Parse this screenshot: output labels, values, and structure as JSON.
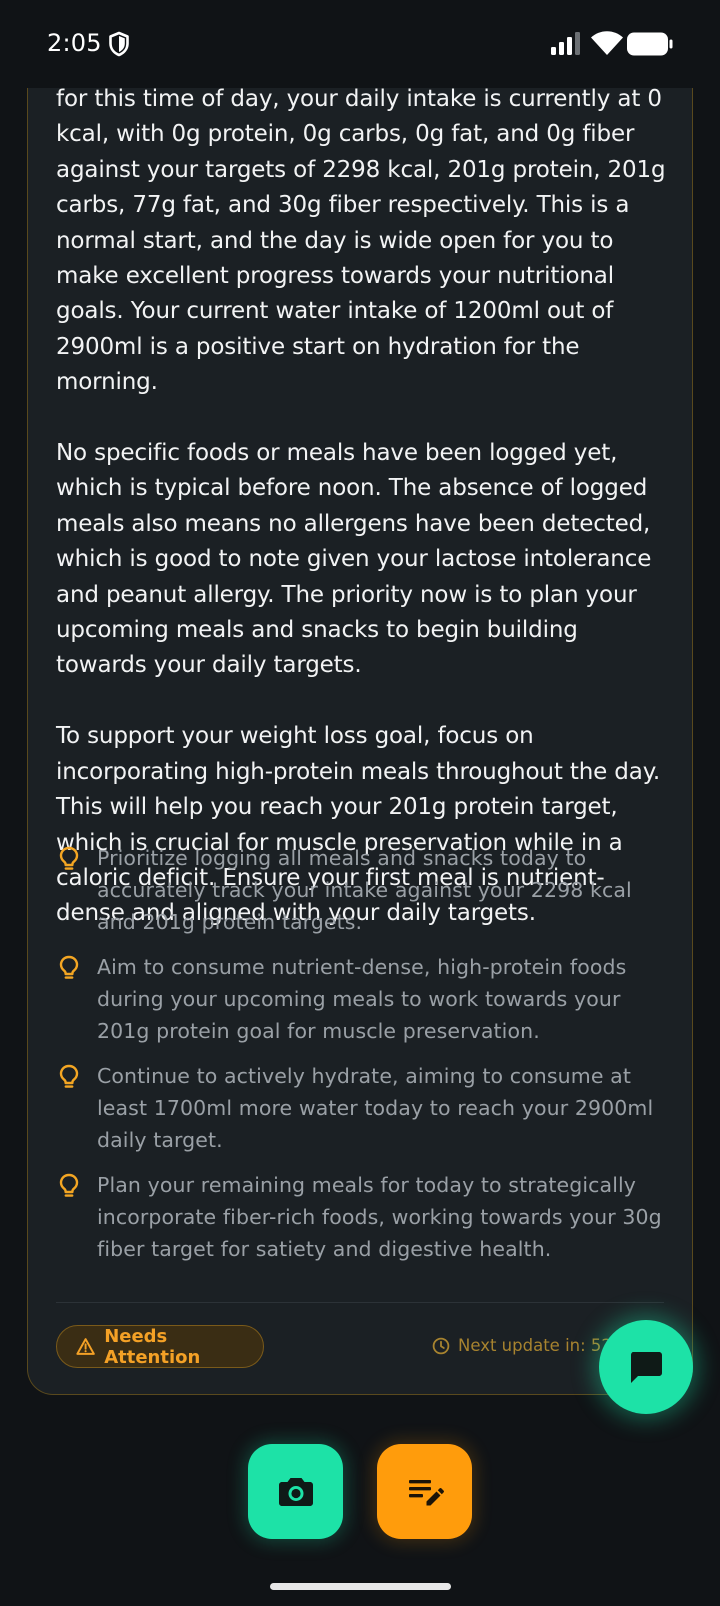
{
  "status_bar": {
    "time": "2:05"
  },
  "insight": {
    "paragraphs": [
      "for this time of day, your daily intake is currently at 0 kcal, with 0g protein, 0g carbs, 0g fat, and 0g fiber against your targets of 2298 kcal, 201g protein, 201g carbs, 77g fat, and 30g fiber respectively. This is a normal start, and the day is wide open for you to make excellent progress towards your nutritional goals. Your current water intake of 1200ml out of 2900ml is a positive start on hydration for the morning.",
      "No specific foods or meals have been logged yet, which is typical before noon. The absence of logged meals also means no allergens have been detected, which is good to note given your lactose intolerance and peanut allergy. The priority now is to plan your upcoming meals and snacks to begin building towards your daily targets.",
      "To support your weight loss goal, focus on incorporating high-protein meals throughout the day. This will help you reach your 201g protein target, which is crucial for muscle preservation while in a caloric deficit. Ensure your first meal is nutrient-dense and aligned with your daily targets."
    ],
    "tips": [
      "Prioritize logging all meals and snacks today to accurately track your intake against your 2298 kcal and 201g protein targets.",
      "Aim to consume nutrient-dense, high-protein foods during your upcoming meals to work towards your 201g protein goal for muscle preservation.",
      "Continue to actively hydrate, aiming to consume at least 1700ml more water today to reach your 2900ml daily target.",
      "Plan your remaining meals for today to strategically incorporate fiber-rich foods, working towards your 30g fiber target for satiety and digestive health."
    ],
    "status_badge": "Needs Attention",
    "next_update": "Next update in: 52"
  },
  "icons": {
    "tip": "lightbulb-icon",
    "badge": "warning-triangle-icon",
    "next_update": "clock-icon",
    "chat": "chat-bubble-icon",
    "camera": "camera-icon",
    "edit": "edit-note-icon"
  },
  "colors": {
    "background": "#101316",
    "card": "#1b2024",
    "accent_green": "#1de2a7",
    "accent_orange": "#ff9c0c",
    "warning_amber": "#f4a126"
  }
}
